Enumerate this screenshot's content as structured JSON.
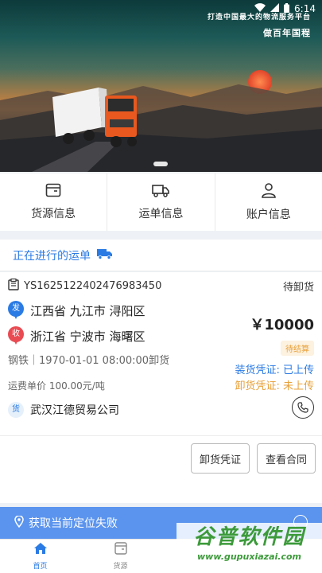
{
  "status_bar": {
    "time": "6:14"
  },
  "banner": {
    "slogan_line1": "打造中国最大的物流服务平台",
    "slogan_line2": "做百年国程"
  },
  "quick_menu": [
    {
      "label": "货源信息",
      "icon": "document-icon"
    },
    {
      "label": "运单信息",
      "icon": "truck-icon"
    },
    {
      "label": "账户信息",
      "icon": "user-icon"
    }
  ],
  "active_orders": {
    "title": "正在进行的运单"
  },
  "order": {
    "number": "YS1625122402476983450",
    "status": "待卸货",
    "origin": {
      "badge": "发",
      "address": "江西省 九江市 浔阳区",
      "color": "#2b7be4"
    },
    "destination": {
      "badge": "收",
      "address": "浙江省 宁波市 海曙区",
      "color": "#e94b53"
    },
    "price": "￥10000",
    "payment_status": "待结算",
    "goods_info": "钢铁｜1970-01-01 08:00:00卸货",
    "loading_proof": "装货凭证: 已上传",
    "unloading_proof": "卸货凭证: 未上传",
    "unit_price": "运费单价 100.00元/吨",
    "company_badge": "货",
    "company": "武汉江德贸易公司",
    "buttons": {
      "unload_proof": "卸货凭证",
      "view_contract": "查看合同"
    }
  },
  "location_bar": {
    "message": "获取当前定位失败"
  },
  "tabbar": [
    {
      "label": "首页",
      "icon": "home-icon",
      "active": true
    },
    {
      "label": "货源",
      "icon": "cargo-icon",
      "active": false
    }
  ],
  "watermark": {
    "title": "谷普软件园",
    "url": "www.gupuxiazai.com"
  },
  "colors": {
    "accent": "#2b7be4",
    "warning": "#e8a13a",
    "location_bar": "#5b94ee"
  }
}
